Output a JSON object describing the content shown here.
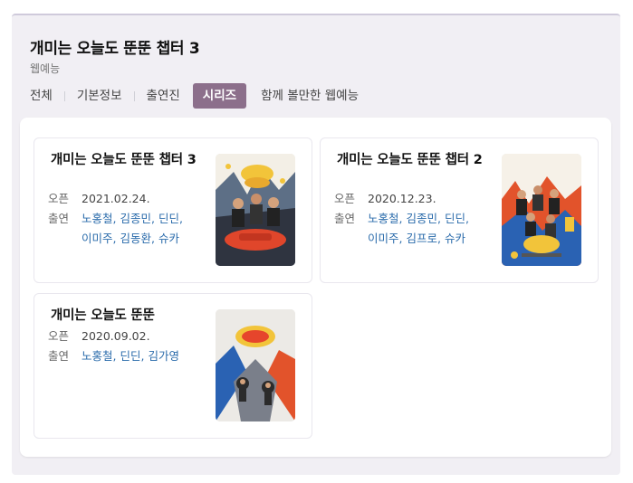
{
  "header": {
    "title": "개미는 오늘도 뚠뚠 챕터 3",
    "subtitle": "웹예능"
  },
  "tabs": [
    {
      "label": "전체"
    },
    {
      "label": "기본정보"
    },
    {
      "label": "출연진"
    },
    {
      "label": "시리즈",
      "active": true
    },
    {
      "label": "함께 볼만한 웹예능"
    }
  ],
  "labels": {
    "open": "오픈",
    "cast": "출연"
  },
  "series": [
    {
      "title": "개미는 오늘도 뚠뚠 챕터 3",
      "open_date": "2021.02.24.",
      "cast": [
        "노홍철",
        "김종민",
        "딘딘",
        "이미주",
        "김동환",
        "슈카"
      ]
    },
    {
      "title": "개미는 오늘도 뚠뚠 챕터 2",
      "open_date": "2020.12.23.",
      "cast": [
        "노홍철",
        "김종민",
        "딘딘",
        "이미주",
        "김프로",
        "슈카"
      ]
    },
    {
      "title": "개미는 오늘도 뚠뚠",
      "open_date": "2020.09.02.",
      "cast": [
        "노홍철",
        "딘딘",
        "김가영"
      ]
    }
  ],
  "colors": {
    "active_tab": "#8c6f8b",
    "panel_bg": "#f1eff4",
    "cast_link": "#2a6bab"
  }
}
